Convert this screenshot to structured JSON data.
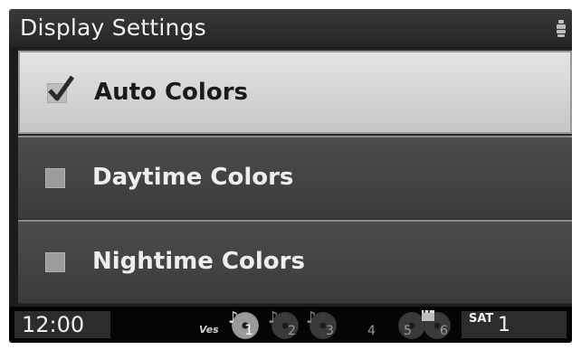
{
  "header": {
    "title": "Display Settings",
    "icon": "seat-icon"
  },
  "menu": {
    "items": [
      {
        "label": "Auto Colors",
        "checked": true,
        "selected": true
      },
      {
        "label": "Daytime Colors",
        "checked": false,
        "selected": false
      },
      {
        "label": "Nightime Colors",
        "checked": false,
        "selected": false
      }
    ]
  },
  "status_bar": {
    "clock": "12:00",
    "ves_label": "Ves",
    "presets": [
      {
        "number": "1",
        "active": true
      },
      {
        "number": "2",
        "active": false
      },
      {
        "number": "3",
        "active": false
      },
      {
        "number": "4",
        "active": false
      },
      {
        "number": "5",
        "active": false
      },
      {
        "number": "6",
        "active": false
      }
    ],
    "sat_label": "SAT",
    "sat_channel": "1"
  },
  "colors": {
    "selected_row": "#d6d6d6",
    "normal_row": "#444444",
    "background": "#1c1c1c"
  }
}
